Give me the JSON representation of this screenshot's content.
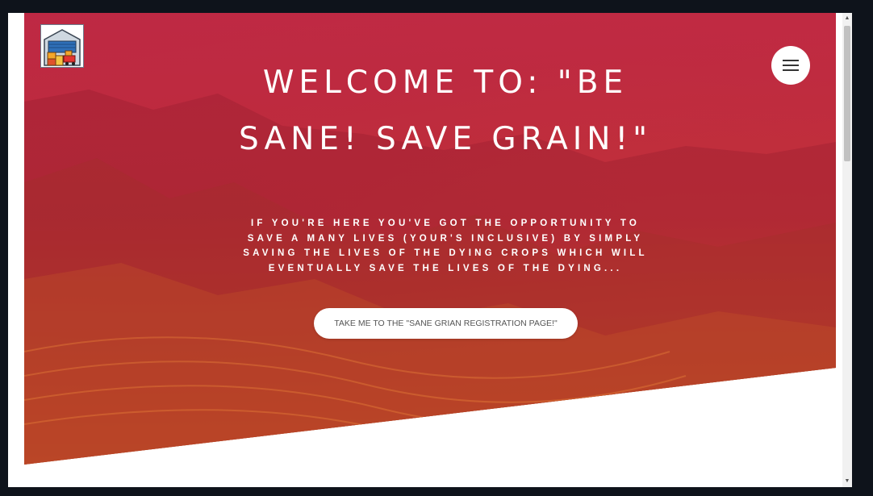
{
  "hero": {
    "title": "WELCOME TO: \"BE SANE! SAVE GRAIN!\"",
    "subtitle": "IF YOU'RE HERE YOU'VE GOT THE OPPORTUNITY TO SAVE A MANY LIVES (YOUR'S INCLUSIVE) BY SIMPLY SAVING THE LIVES OF THE DYING CROPS WHICH WILL EVENTUALLY SAVE THE LIVES OF THE DYING...",
    "cta_label": "TAKE ME TO THE \"SANE GRIAN REGISTRATION PAGE!\""
  },
  "logo": {
    "icon": "warehouse-icon"
  },
  "menu": {
    "icon": "hamburger-menu-icon"
  },
  "scrollbar": {
    "up_glyph": "▲",
    "down_glyph": "▼"
  },
  "colors": {
    "overlay": "#d2283f",
    "background": "#0e131b",
    "button_bg": "#ffffff"
  }
}
